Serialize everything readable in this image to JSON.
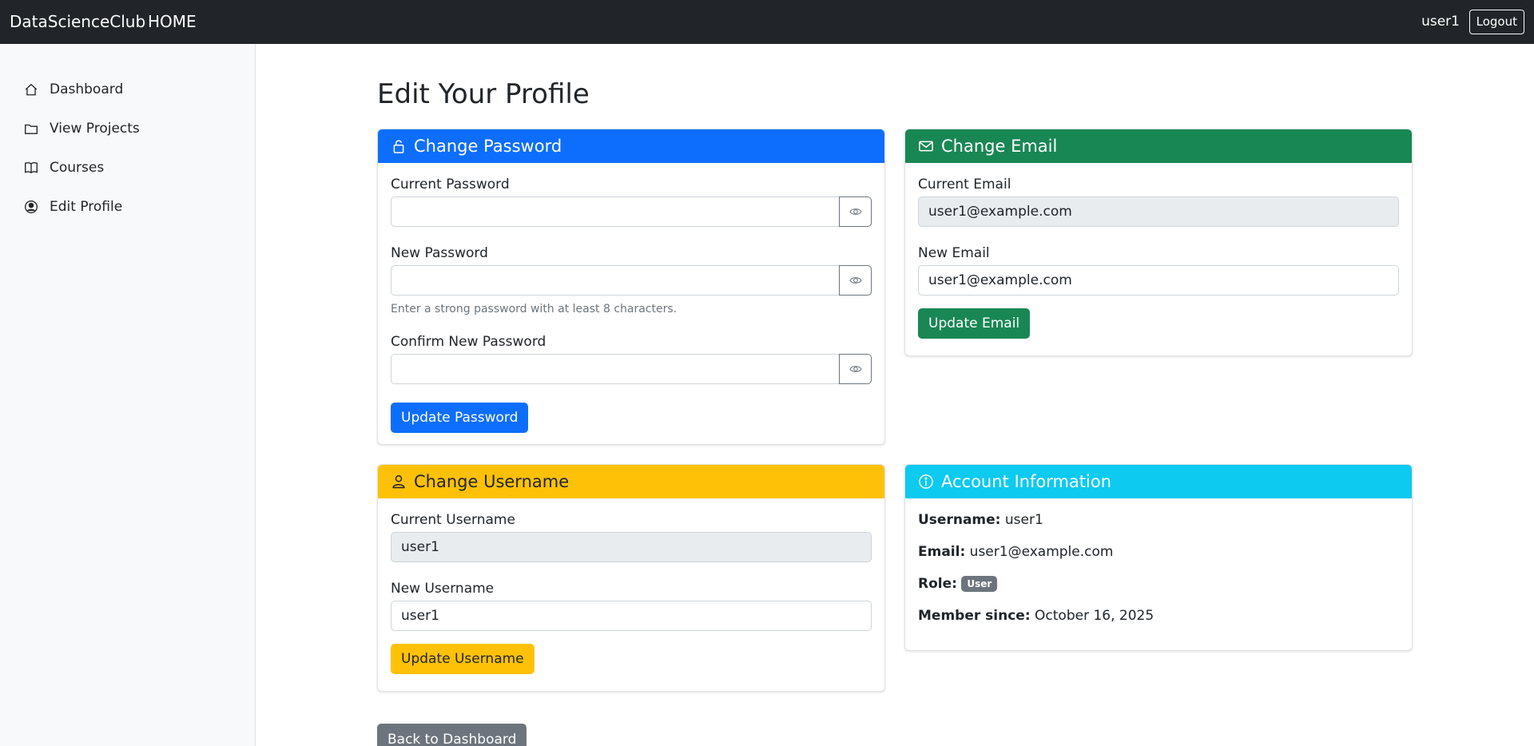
{
  "navbar": {
    "brand": "DataScienceClub",
    "home": "HOME",
    "user": "user1",
    "logout": "Logout"
  },
  "sidebar": {
    "items": [
      {
        "label": "Dashboard",
        "icon": "home-icon"
      },
      {
        "label": "View Projects",
        "icon": "folder-icon"
      },
      {
        "label": "Courses",
        "icon": "book-icon"
      },
      {
        "label": "Edit Profile",
        "icon": "person-circle-icon"
      }
    ]
  },
  "page": {
    "title": "Edit Your Profile",
    "back_button": "Back to Dashboard"
  },
  "password_card": {
    "title": "Change Password",
    "header_color": "#0d6efd",
    "current_label": "Current Password",
    "current_value": "",
    "new_label": "New Password",
    "new_value": "",
    "new_help": "Enter a strong password with at least 8 characters.",
    "confirm_label": "Confirm New Password",
    "confirm_value": "",
    "button": "Update Password"
  },
  "email_card": {
    "title": "Change Email",
    "header_color": "#198754",
    "current_label": "Current Email",
    "current_value": "user1@example.com",
    "new_label": "New Email",
    "new_value": "user1@example.com",
    "button": "Update Email"
  },
  "username_card": {
    "title": "Change Username",
    "header_color": "#ffc107",
    "current_label": "Current Username",
    "current_value": "user1",
    "new_label": "New Username",
    "new_value": "user1",
    "button": "Update Username"
  },
  "account_card": {
    "title": "Account Information",
    "header_color": "#0dcaf0",
    "username_label": "Username:",
    "username_value": "user1",
    "email_label": "Email:",
    "email_value": "user1@example.com",
    "role_label": "Role:",
    "role_value": "User",
    "member_label": "Member since:",
    "member_value": "October 16, 2025"
  }
}
